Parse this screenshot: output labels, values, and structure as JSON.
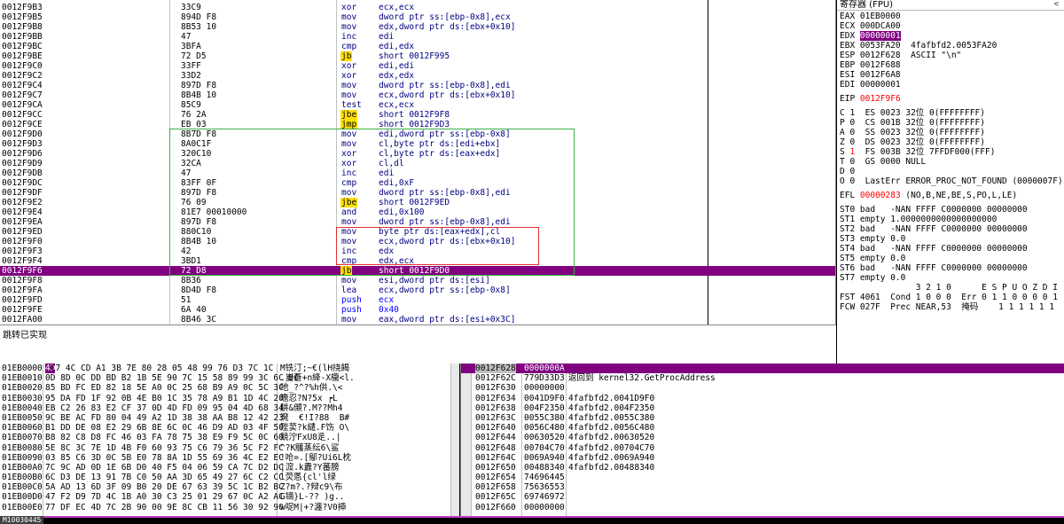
{
  "disasm": {
    "rows": [
      {
        "addr": "0012F9B3",
        "hex": "33C9",
        "mn": "xor",
        "op": "ecx,ecx"
      },
      {
        "addr": "0012F9B5",
        "hex": "894D F8",
        "mn": "mov",
        "op": "dword ptr ss:[ebp-0x8],ecx"
      },
      {
        "addr": "0012F9B8",
        "hex": "8B53 10",
        "mn": "mov",
        "op": "edx,dword ptr ds:[ebx+0x10]"
      },
      {
        "addr": "0012F9BB",
        "hex": "47",
        "mn": "inc",
        "op": "edi"
      },
      {
        "addr": "0012F9BC",
        "hex": "3BFA",
        "mn": "cmp",
        "op": "edi,edx"
      },
      {
        "addr": "0012F9BE",
        "hex": "72 D5",
        "mn": "jb",
        "op": "short 0012F995",
        "jmp": true
      },
      {
        "addr": "0012F9C0",
        "hex": "33FF",
        "mn": "xor",
        "op": "edi,edi"
      },
      {
        "addr": "0012F9C2",
        "hex": "33D2",
        "mn": "xor",
        "op": "edx,edx"
      },
      {
        "addr": "0012F9C4",
        "hex": "897D F8",
        "mn": "mov",
        "op": "dword ptr ss:[ebp-0x8],edi"
      },
      {
        "addr": "0012F9C7",
        "hex": "8B4B 10",
        "mn": "mov",
        "op": "ecx,dword ptr ds:[ebx+0x10]"
      },
      {
        "addr": "0012F9CA",
        "hex": "85C9",
        "mn": "test",
        "op": "ecx,ecx"
      },
      {
        "addr": "0012F9CC",
        "hex": "76 2A",
        "mn": "jbe",
        "op": "short 0012F9F8",
        "jmp": true
      },
      {
        "addr": "0012F9CE",
        "hex": "EB 03",
        "mn": "jmp",
        "op": "short 0012F9D3",
        "jmp": true
      },
      {
        "addr": "0012F9D0",
        "hex": "8B7D F8",
        "mn": "mov",
        "op": "edi,dword ptr ss:[ebp-0x8]"
      },
      {
        "addr": "0012F9D3",
        "hex": "8A0C1F",
        "mn": "mov",
        "op": "cl,byte ptr ds:[edi+ebx]"
      },
      {
        "addr": "0012F9D6",
        "hex": "320C10",
        "mn": "xor",
        "op": "cl,byte ptr ds:[eax+edx]"
      },
      {
        "addr": "0012F9D9",
        "hex": "32CA",
        "mn": "xor",
        "op": "cl,dl"
      },
      {
        "addr": "0012F9DB",
        "hex": "47",
        "mn": "inc",
        "op": "edi"
      },
      {
        "addr": "0012F9DC",
        "hex": "83FF 0F",
        "mn": "cmp",
        "op": "edi,0xF"
      },
      {
        "addr": "0012F9DF",
        "hex": "897D F8",
        "mn": "mov",
        "op": "dword ptr ss:[ebp-0x8],edi"
      },
      {
        "addr": "0012F9E2",
        "hex": "76 09",
        "mn": "jbe",
        "op": "short 0012F9ED",
        "jmp": true
      },
      {
        "addr": "0012F9E4",
        "hex": "81E7 00010000",
        "mn": "and",
        "op": "edi,0x100"
      },
      {
        "addr": "0012F9EA",
        "hex": "897D F8",
        "mn": "mov",
        "op": "dword ptr ss:[ebp-0x8],edi"
      },
      {
        "addr": "0012F9ED",
        "hex": "880C10",
        "mn": "mov",
        "op": "byte ptr ds:[eax+edx],cl"
      },
      {
        "addr": "0012F9F0",
        "hex": "8B4B 10",
        "mn": "mov",
        "op": "ecx,dword ptr ds:[ebx+0x10]"
      },
      {
        "addr": "0012F9F3",
        "hex": "42",
        "mn": "inc",
        "op": "edx"
      },
      {
        "addr": "0012F9F4",
        "hex": "3BD1",
        "mn": "cmp",
        "op": "edx,ecx"
      },
      {
        "addr": "0012F9F6",
        "hex": "72 D8",
        "mn": "jb",
        "op": "short 0012F9D0",
        "jmp": true,
        "sel": true
      },
      {
        "addr": "0012F9F8",
        "hex": "8B36",
        "mn": "mov",
        "op": "esi,dword ptr ds:[esi]"
      },
      {
        "addr": "0012F9FA",
        "hex": "8D4D F8",
        "mn": "lea",
        "op": "ecx,dword ptr ss:[ebp-0x8]"
      },
      {
        "addr": "0012F9FD",
        "hex": "51",
        "mn": "push",
        "op": "ecx",
        "push": true
      },
      {
        "addr": "0012F9FE",
        "hex": "6A 40",
        "mn": "push",
        "op": "0x40",
        "push": true
      },
      {
        "addr": "0012FA00",
        "hex": "8B46 3C",
        "mn": "mov",
        "op": "eax,dword ptr ds:[esi+0x3C]"
      }
    ]
  },
  "info": {
    "text": "跳转已实现"
  },
  "registers": {
    "title": "寄存器 (FPU)",
    "arrow": "<",
    "lines": [
      {
        "text": "EAX 01EB0000"
      },
      {
        "text": "ECX 000DCA00"
      },
      {
        "name": "EDX",
        "val": "00000001",
        "boxed": true
      },
      {
        "text": "EBX 0053FA20  4fafbfd2.0053FA20"
      },
      {
        "text": "ESP 0012F628  ASCII \"\\n\""
      },
      {
        "text": "EBP 0012F688"
      },
      {
        "text": "ESI 0012F6A8"
      },
      {
        "text": "EDI 00000001"
      },
      {
        "text": ""
      },
      {
        "name": "EIP",
        "val": "0012F9F6",
        "red": true
      },
      {
        "text": ""
      },
      {
        "text": "C 1  ES 0023 32位 0(FFFFFFFF)"
      },
      {
        "text": "P 0  CS 001B 32位 0(FFFFFFFF)"
      },
      {
        "text": "A 0  SS 0023 32位 0(FFFFFFFF)"
      },
      {
        "text": "Z 0  DS 0023 32位 0(FFFFFFFF)"
      },
      {
        "name": "S",
        "val": "1",
        "red": true,
        "rest": "  FS 003B 32位 7FFDF000(FFF)"
      },
      {
        "text": "T 0  GS 0000 NULL"
      },
      {
        "text": "D 0"
      },
      {
        "text": "O 0  LastErr ERROR_PROC_NOT_FOUND (0000007F)"
      },
      {
        "text": ""
      },
      {
        "name": "EFL",
        "val": "00000283",
        "red": true,
        "rest": " (NO,B,NE,BE,S,PO,L,LE)"
      },
      {
        "text": ""
      },
      {
        "text": "ST0 bad   -NAN FFFF C0000000 00000000"
      },
      {
        "text": "ST1 empty 1.0000000000000000000"
      },
      {
        "text": "ST2 bad   -NAN FFFF C0000000 00000000"
      },
      {
        "text": "ST3 empty 0.0"
      },
      {
        "text": "ST4 bad   -NAN FFFF C0000000 00000000"
      },
      {
        "text": "ST5 empty 0.0"
      },
      {
        "text": "ST6 bad   -NAN FFFF C0000000 00000000"
      },
      {
        "text": "ST7 empty 0.0"
      },
      {
        "text": "               3 2 1 0      E S P U O Z D I"
      },
      {
        "text": "FST 4061  Cond 1 0 0 0  Err 0 1 1 0 0 0 0 1"
      },
      {
        "text": "FCW 027F  Prec NEAR,53  掩码    1 1 1 1 1 1"
      }
    ]
  },
  "dump": {
    "rows": [
      {
        "addr": "01EB0000",
        "first": "4D",
        "hex": " C7 4C CD A1 3B 7E 80 28 05 48 99 76 D3 7C 1C",
        "asc": "M铣汀;~€(lH挠餲"
      },
      {
        "addr": "01EB0010",
        "hex": "0D 8D 0C DD BD B2 1B 5E 90 7C 15 58 89 99 3C 6C 0C",
        "asc": ".嵏蒼+n絳-X櫳<l."
      },
      {
        "addr": "01EB0020",
        "hex": "85 BD FC ED 82 18 5E A0 0C 25 68 B9 A9 0C 5C 3C",
        "asc": "吔_?^?%h供.\\<"
      },
      {
        "addr": "01EB0030",
        "hex": "95 DA FD 1F 92 0B 4E B0 1C 35 78 A9 B1 1D 4C 20",
        "asc": "曕忍?N?5x ┍L "
      },
      {
        "addr": "01EB0040",
        "hex": "EB C2 26 83 E2 CF 37 0D 4D FD 09 95 04 4D 68 34",
        "asc": "肼&儭?.M??Mh4"
      },
      {
        "addr": "01EB0050",
        "hex": "9C BE AC FD 80 04 49 A2 1D 38 38 AA B8 12 42 23",
        "asc": "溌  €!I?88  B#"
      },
      {
        "addr": "01EB0060",
        "hex": "B1 DD DE 08 E2 29 6B 8E 6C 0C 46 D9 AD 03 4F 50",
        "asc": "陛荬?k繾.F饬 O\\"
      },
      {
        "addr": "01EB0070",
        "hex": "B8 82 C8 D8 FC 46 03 FA 78 75 38 E9 F9 5C 0C 60",
        "asc": "競泞FxU8辵..|"
      },
      {
        "addr": "01EB0080",
        "hex": "5E 8C 3C 7E 1D 4B F0 60 93 75 C6 79 36 5C F2 FC",
        "asc": "^?K鸌蒸纭6\\鲨"
      },
      {
        "addr": "01EB0090",
        "hex": "03 85 C6 3D 0C 5B E0 78 8A 1D 55 69 36 4C E2 EC",
        "asc": "!呛=.[鄥?Ui6L枕"
      },
      {
        "addr": "01EB00A0",
        "hex": "7C 9C AD 0D 1E 6B D0 40 F5 04 06 59 CA 7C D2 DC",
        "asc": "|溛.k纛?Y蕃膀"
      },
      {
        "addr": "01EB00B0",
        "hex": "6C D3 DE 13 91 7B C0 50 AA 3D 65 49 27 6C C2 CC",
        "asc": "l荧悘{cl'l绿"
      },
      {
        "addr": "01EB00C0",
        "hex": "5A AD 13 6D 3F 09 B0 20 DE 67 63 39 5C 1C B2 BC",
        "asc": "Z?m?.?辩c9\\布"
      },
      {
        "addr": "01EB00D0",
        "hex": "47 F2 D9 7D 4C 1B A0 30 C3 25 01 29 67 0C A2 AC",
        "asc": "G镝}L-?? )g.."
      },
      {
        "addr": "01EB00E0",
        "hex": "77 DF EC 4D 7C 2B 90 00 9E 8C CB 11 56 30 92 90",
        "asc": "w哫M|+?瀍?V0揷"
      }
    ]
  },
  "stack": {
    "rows": [
      {
        "addr": "0012F628",
        "val": "0000000A",
        "cmt": "",
        "top": true
      },
      {
        "addr": "0012F62C",
        "val": "779D33D3",
        "cmt": "返回到 kernel32.GetProcAddress"
      },
      {
        "addr": "0012F630",
        "val": "00000000",
        "cmt": ""
      },
      {
        "addr": "0012F634",
        "val": "0041D9F0",
        "cmt": "4fafbfd2.0041D9F0"
      },
      {
        "addr": "0012F638",
        "val": "004F2350",
        "cmt": "4fafbfd2.004F2350"
      },
      {
        "addr": "0012F63C",
        "val": "0055C380",
        "cmt": "4fafbfd2.0055C380"
      },
      {
        "addr": "0012F640",
        "val": "0056C480",
        "cmt": "4fafbfd2.0056C480"
      },
      {
        "addr": "0012F644",
        "val": "00630520",
        "cmt": "4fafbfd2.00630520"
      },
      {
        "addr": "0012F648",
        "val": "00704C70",
        "cmt": "4fafbfd2.00704C70"
      },
      {
        "addr": "0012F64C",
        "val": "0069A940",
        "cmt": "4fafbfd2.0069A940"
      },
      {
        "addr": "0012F650",
        "val": "00488340",
        "cmt": "4fafbfd2.00488340"
      },
      {
        "addr": "0012F654",
        "val": "74696445",
        "cmt": ""
      },
      {
        "addr": "0012F658",
        "val": "75636553",
        "cmt": ""
      },
      {
        "addr": "0012F65C",
        "val": "69746972",
        "cmt": ""
      },
      {
        "addr": "0012F660",
        "val": "00000000",
        "cmt": ""
      }
    ]
  },
  "cmdbar": {
    "text": "M10030445"
  }
}
